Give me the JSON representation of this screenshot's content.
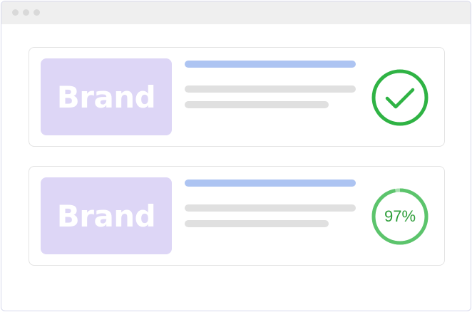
{
  "colors": {
    "success_green": "#2fb344",
    "progress_track": "#a8e0b0",
    "progress_fill": "#5cc46c",
    "brand_tile": "#ddd6f6",
    "title_bar_blue": "#adc4f2",
    "placeholder_gray": "#e0e0e0"
  },
  "cards": [
    {
      "brand": "Brand",
      "status_icon": "check-circle-icon"
    },
    {
      "brand": "Brand",
      "status_icon": "progress-ring-icon",
      "progress_label": "97%",
      "progress_fraction": 0.97
    }
  ]
}
